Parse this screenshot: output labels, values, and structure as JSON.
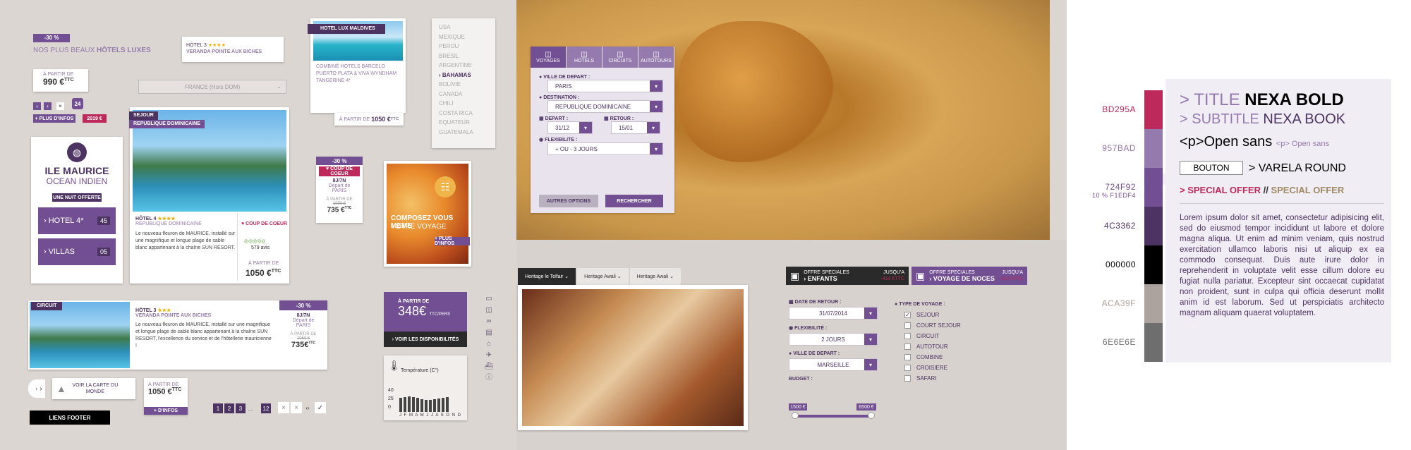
{
  "colors": {
    "accent": "#724F92",
    "dark": "#4C3362",
    "pink": "#BD295A",
    "lav": "#957BAD",
    "black": "#000000",
    "grey": "#ACA39F",
    "light": "#6E6E6E"
  },
  "promo": {
    "discount": "-30 %",
    "line": "NOS PLUS BEAUX",
    "bold": "HÔTELS LUXES",
    "from": "À PARTIR DE",
    "price": "990 €",
    "ttc": "TTC",
    "plus_infos": "+ PLUS D'INFOS",
    "year": "2019 €",
    "count": "24"
  },
  "hotel_chip": {
    "label": "HÔTEL 3",
    "stars": "★★★★",
    "name": "VERANDA POINTE AUX BICHES"
  },
  "dropdown_france": "FRANCE (Hors DOM)",
  "maldives": {
    "tag": "HOTEL LUX MALDIVES",
    "desc": "COMBINÉ HOTELS BARCELO PUERTO PLATA & VIVA WYNDHAM TANGERINE 4*",
    "from": "À PARTIR DE",
    "price": "1050 €",
    "ttc": "TTC"
  },
  "countries": [
    "USA",
    "MEXIQUE",
    "PEROU",
    "BRESIL",
    "ARGENTINE",
    "BAHAMAS",
    "BOLIVIE",
    "CANADA",
    "CHILI",
    "COSTA RICA",
    "EQUATEUR",
    "GUATEMALA"
  ],
  "selected_country": "BAHAMAS",
  "ile": {
    "title": "ILE MAURICE",
    "sub": "OCEAN INDIEN",
    "offer": "UNE NUIT OFFERTE",
    "items": [
      {
        "label": "HOTEL 4*",
        "count": "45"
      },
      {
        "label": "VILLAS",
        "count": "05"
      }
    ]
  },
  "dom": {
    "tag": "SEJOUR",
    "country": "REPUBLIQUE DOMINICAINE",
    "hotel": "HÔTEL 4",
    "stars": "★★★★",
    "dest": "REPUBLIQUE DOMINICAINE",
    "coeur": "COUP DE COEUR",
    "text": "Le nouveau fleuron de MAURICE, installé sur une magnifique et longue plage de sable blanc appartenant à la chaîne SUN RESORT.",
    "avis": "579 avis",
    "from": "À PARTIR DE",
    "price": "1050 €",
    "ttc": "TTC"
  },
  "mini": {
    "discount": "-30 %",
    "coeur": "COUP DE COEUR",
    "nights": "8J/7N",
    "dep": "Départ de",
    "city": "PARIS",
    "from": "À PARTIR DE",
    "old": "1050 €",
    "price": "735 €",
    "ttc": "TTC"
  },
  "compose": {
    "line1": "COMPOSEZ VOUS MEME",
    "line2": "VOTRE VOYAGE",
    "cta": "+ PLUS D'INFOS"
  },
  "search": {
    "tabs": [
      "VOYAGES",
      "HOTELS",
      "CIRCUITS",
      "AUTOTOURS"
    ],
    "dep_label": "VILLE DE DEPART :",
    "dep": "PARIS",
    "dest_label": "DESTINATION :",
    "dest": "REPUBLIQUE DOMINICAINE",
    "depart_label": "DEPART :",
    "depart": "31/12",
    "retour_label": "RETOUR :",
    "retour": "15/01",
    "flex_label": "FLEXIBILITE :",
    "flex": "+ OU - 3 JOURS",
    "more": "AUTRES OPTIONS",
    "go": "RECHERCHER"
  },
  "circuit": {
    "tag": "CIRCUIT",
    "hotel": "HÔTEL 3",
    "stars": "★★★",
    "name": "VERANDA POINTE AUX BICHES",
    "discount": "-30 %",
    "text": "Le nouveau fleuron de MAURICE, installé sur une magnifique et longue plage de sable blanc appartenant à la chaîne SUN RESORT, l'excellence du service et de l'hôtellerie mauricienne !",
    "nights": "8J/7N",
    "dep": "Départ de",
    "city": "PARIS",
    "from": "À PARTIR DE",
    "old": "1050 €",
    "price": "735€",
    "ttc": "TTC"
  },
  "price_box": {
    "from": "À PARTIR DE",
    "price": "348€",
    "per": "TTC/PERS",
    "cta": "VOIR LES DISPONIBILITÉS"
  },
  "temp": {
    "title": "Température (C°)",
    "ticks": [
      "40",
      "25",
      "0"
    ],
    "months": "J F M A M J J A S O N D",
    "values": [
      22,
      23,
      24,
      23,
      22,
      20,
      19,
      19,
      20,
      21,
      22,
      23
    ]
  },
  "map_btn": "VOIR LA CARTE DU MONDE",
  "bottom_price": {
    "from": "À PARTIR DE",
    "price": "1050 €",
    "ttc": "TTC",
    "cta": "+ D'INFOS"
  },
  "pagination": [
    "1",
    "2",
    "3",
    "...",
    "12"
  ],
  "footer": "LIENS FOOTER",
  "room_tabs": [
    "Heritage le Telfair",
    "Heritage Awali",
    "Heritage Awali"
  ],
  "offers": [
    {
      "label": "OFFRE SPECIALES",
      "bold": "ENFANTS",
      "until": "JUSQU'A",
      "val": "-413 €TTC"
    },
    {
      "label": "OFFRE SPECIALES",
      "bold": "VOYAGE DE NOCES",
      "until": "JUSQU'A",
      "val": "-413 €TTC"
    }
  ],
  "form": {
    "retour_label": "DATE DE RETOUR :",
    "retour": "31/07/2014",
    "flex_label": "FLEXIBILITÉ :",
    "flex": "2 JOURS",
    "dep_label": "VILLE DE DEPART :",
    "dep": "MARSEILLE",
    "budget": "BUDGET :",
    "min": "1500 €",
    "max": "6500 €",
    "type_label": "TYPE DE VOYAGE :",
    "types": [
      "SEJOUR",
      "COURT SEJOUR",
      "CIRCUIT",
      "AUTOTOUR",
      "COMBINE",
      "CROISIERE",
      "SAFARI"
    ]
  },
  "style": {
    "swatches": [
      "BD295A",
      "957BAD",
      "724F92",
      "4C3362",
      "000000",
      "ACA39F",
      "6E6E6E"
    ],
    "sub_hex": "10 % F1EDF4",
    "title_a": "> TITLE",
    "title_b": "NEXA BOLD",
    "subtitle_a": "> SUBTITLE",
    "subtitle_b": "NEXA BOOK",
    "p_tag": "<p>Open sans",
    "p_small": "<p> Open sans",
    "bouton": "BOUTON",
    "varela": "> VARELA ROUND",
    "offer_a": "> SPECIAL OFFER",
    "sep": "//",
    "offer_b": "SPECIAL OFFER",
    "lorem": "Lorem ipsum dolor sit amet, consectetur adipisicing elit, sed do eiusmod tempor incididunt ut labore et dolore magna aliqua. Ut enim ad minim veniam, quis nostrud exercitation ullamco laboris nisi ut aliquip ex ea commodo consequat. Duis aute irure dolor in reprehenderit in voluptate velit esse cillum dolore eu fugiat nulla pariatur. Excepteur sint occaecat cupidatat non proident, sunt in culpa qui officia deserunt mollit anim id est laborum. Sed ut perspiciatis architecto magnam aliquam quaerat voluptatem."
  }
}
